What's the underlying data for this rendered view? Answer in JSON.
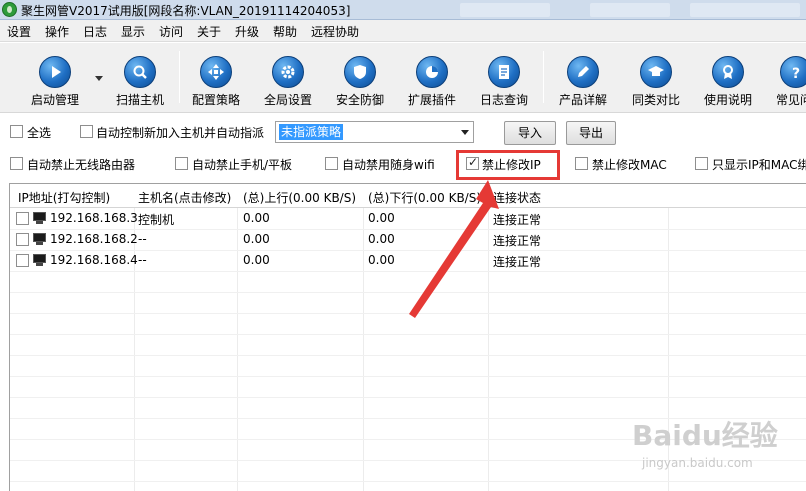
{
  "window": {
    "title": "聚生网管V2017试用版[网段名称:VLAN_20191114204053]"
  },
  "menu": [
    "设置",
    "操作",
    "日志",
    "显示",
    "访问",
    "关于",
    "升级",
    "帮助",
    "远程协助"
  ],
  "toolbar": {
    "buttons": [
      {
        "label": "启动管理",
        "icon": "play-icon"
      },
      {
        "label": "扫描主机",
        "icon": "search-icon"
      },
      {
        "label": "配置策略",
        "icon": "move-arrows-icon"
      },
      {
        "label": "全局设置",
        "icon": "gear-icon"
      },
      {
        "label": "安全防御",
        "icon": "shield-icon"
      },
      {
        "label": "扩展插件",
        "icon": "pie-chart-icon"
      },
      {
        "label": "日志查询",
        "icon": "document-icon"
      },
      {
        "label": "产品详解",
        "icon": "edit-icon"
      },
      {
        "label": "同类对比",
        "icon": "graduation-cap-icon"
      },
      {
        "label": "使用说明",
        "icon": "ribbon-icon"
      },
      {
        "label": "常见问",
        "icon": "question-icon"
      }
    ]
  },
  "options": {
    "select_all": "全选",
    "auto_control": "自动控制新加入主机并自动指派",
    "policy_select_value": "未指派策略",
    "import_label": "导入",
    "export_label": "导出",
    "checkboxes": [
      {
        "label": "自动禁止无线路由器",
        "checked": false
      },
      {
        "label": "自动禁止手机/平板",
        "checked": false
      },
      {
        "label": "自动禁用随身wifi",
        "checked": false
      },
      {
        "label": "禁止修改IP",
        "checked": true
      },
      {
        "label": "禁止修改MAC",
        "checked": false
      },
      {
        "label": "只显示IP和MAC绑",
        "checked": false
      }
    ]
  },
  "table": {
    "columns": [
      "IP地址(打勾控制)",
      "主机名(点击修改)",
      "(总)上行(0.00 KB/S)",
      "(总)下行(0.00 KB/S)",
      "连接状态"
    ],
    "rows": [
      {
        "ip": "192.168.168.3",
        "host": "控制机",
        "up": "0.00",
        "down": "0.00",
        "status": "连接正常"
      },
      {
        "ip": "192.168.168.2",
        "host": "--",
        "up": "0.00",
        "down": "0.00",
        "status": "连接正常"
      },
      {
        "ip": "192.168.168.4",
        "host": "--",
        "up": "0.00",
        "down": "0.00",
        "status": "连接正常"
      }
    ]
  },
  "annotation": {
    "highlight_color": "#e53935"
  },
  "watermark": {
    "brand": "Baidu经验",
    "url": "jingyan.baidu.com"
  }
}
